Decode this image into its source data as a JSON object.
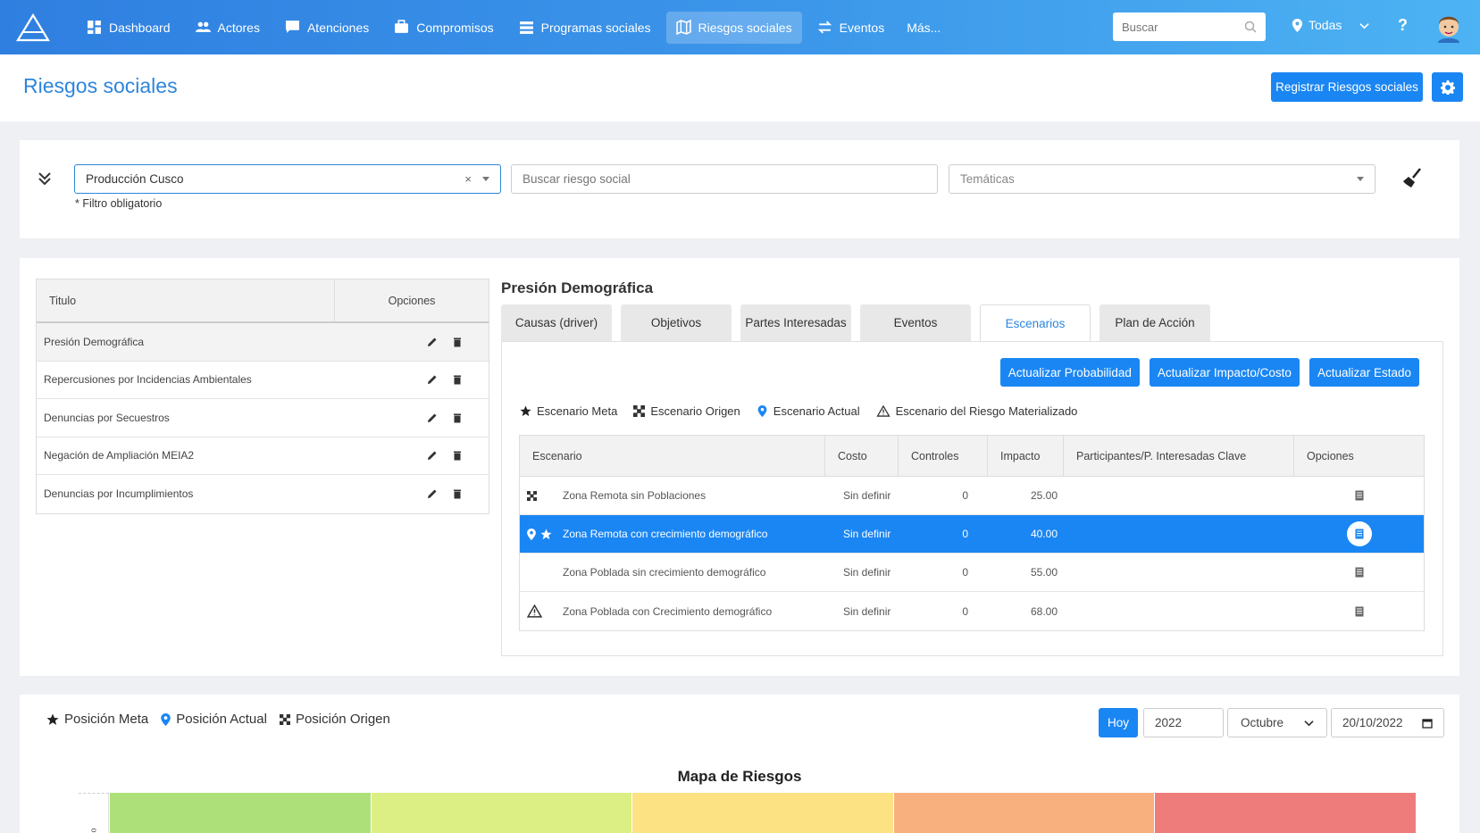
{
  "nav": {
    "items": [
      {
        "label": "Dashboard",
        "icon": "dashboard-icon"
      },
      {
        "label": "Actores",
        "icon": "users-icon"
      },
      {
        "label": "Atenciones",
        "icon": "message-icon"
      },
      {
        "label": "Compromisos",
        "icon": "briefcase-icon"
      },
      {
        "label": "Programas sociales",
        "icon": "list-icon"
      },
      {
        "label": "Riesgos sociales",
        "icon": "map-icon",
        "active": true
      },
      {
        "label": "Eventos",
        "icon": "exchange-icon"
      }
    ],
    "more": "Más...",
    "search_placeholder": "Buscar",
    "location": "Todas",
    "help": "?"
  },
  "page": {
    "title": "Riesgos sociales",
    "register_button": "Registrar Riesgos sociales"
  },
  "filters": {
    "project": "Producción Cusco",
    "clear": "×",
    "hint": "* Filtro obligatorio",
    "search_placeholder": "Buscar riesgo social",
    "tematicas_placeholder": "Temáticas"
  },
  "risks_table": {
    "headers": {
      "title": "Titulo",
      "options": "Opciones"
    },
    "rows": [
      "Presión Demográfica",
      "Repercusiones por Incidencias Ambientales",
      "Denuncias por Secuestros",
      "Negación de Ampliación MEIA2",
      "Denuncias por Incumplimientos"
    ]
  },
  "detail": {
    "title": "Presión Demográfica",
    "tabs": [
      "Causas (driver)",
      "Objetivos",
      "Partes Interesadas",
      "Eventos",
      "Escenarios",
      "Plan de Acción"
    ],
    "active_tab": "Escenarios",
    "actions": [
      "Actualizar Probabilidad",
      "Actualizar Impacto/Costo",
      "Actualizar Estado"
    ],
    "legend": {
      "meta": "Escenario Meta",
      "origen": "Escenario Origen",
      "actual": "Escenario Actual",
      "materializado": "Escenario del Riesgo Materializado"
    },
    "scenarios_headers": {
      "escenario": "Escenario",
      "costo": "Costo",
      "controles": "Controles",
      "impacto": "Impacto",
      "participantes": "Participantes/P. Interesadas Clave",
      "opciones": "Opciones"
    },
    "scenarios": [
      {
        "name": "Zona Remota sin Poblaciones",
        "costo": "Sin definir",
        "controles": "0",
        "impacto": "25.00",
        "markers": [
          "origen"
        ]
      },
      {
        "name": "Zona Remota con crecimiento demográfico",
        "costo": "Sin definir",
        "controles": "0",
        "impacto": "40.00",
        "markers": [
          "actual",
          "meta"
        ],
        "selected": true
      },
      {
        "name": "Zona Poblada sin crecimiento demográfico",
        "costo": "Sin definir",
        "controles": "0",
        "impacto": "55.00",
        "markers": []
      },
      {
        "name": "Zona Poblada con Crecimiento demográfico",
        "costo": "Sin definir",
        "controles": "0",
        "impacto": "68.00",
        "markers": [
          "materializado"
        ]
      }
    ]
  },
  "map": {
    "legend": {
      "meta": "Posición Meta",
      "actual": "Posición Actual",
      "origen": "Posición Origen"
    },
    "today_button": "Hoy",
    "year": "2022",
    "month": "Octubre",
    "date": "20/10/2022",
    "title": "Mapa de Riesgos",
    "axis_label_fragment": "o",
    "cell_colors": [
      "#aee07a",
      "#dbef84",
      "#fde283",
      "#f8b07e",
      "#ee7c7a"
    ]
  },
  "colors": {
    "accent": "#1a86f3",
    "title": "#2d86dc"
  }
}
